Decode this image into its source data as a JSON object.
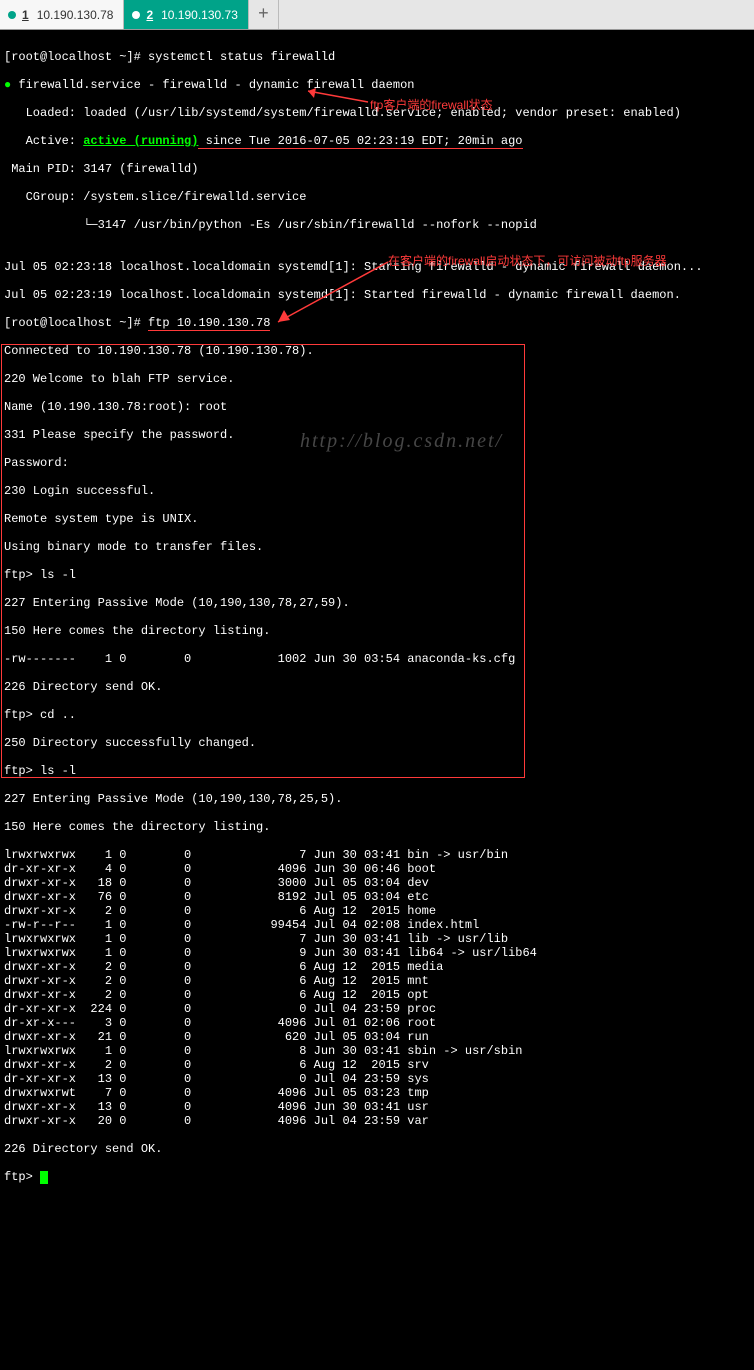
{
  "tabs": {
    "tab1_num": "1",
    "tab1_ip": "10.190.130.78",
    "tab2_num": "2",
    "tab2_ip": "10.190.130.73",
    "newtab": "+"
  },
  "prompt1": "[root@localhost ~]# ",
  "cmd1": "systemctl status firewalld",
  "fw": {
    "l1a": "●",
    "l1b": " firewalld.service - firewalld - dynamic firewall daemon",
    "l2": "   Loaded: loaded (/usr/lib/systemd/system/firewalld.service; enabled; vendor preset: enabled)",
    "l3a": "   Active: ",
    "l3b": "active (running)",
    "l3c": " since Tue 2016-07-05 02:23:19 EDT; 20min ago",
    "l4": " Main PID: 3147 (firewalld)",
    "l5": "   CGroup: /system.slice/firewalld.service",
    "l6": "           └─3147 /usr/bin/python -Es /usr/sbin/firewalld --nofork --nopid",
    "l7": "",
    "l8": "Jul 05 02:23:18 localhost.localdomain systemd[1]: Starting firewalld - dynamic firewall daemon...",
    "l9": "Jul 05 02:23:19 localhost.localdomain systemd[1]: Started firewalld - dynamic firewall daemon."
  },
  "prompt2": "[root@localhost ~]# ",
  "cmd2": "ftp 10.190.130.78",
  "ftp": {
    "l1": "Connected to 10.190.130.78 (10.190.130.78).",
    "l2": "220 Welcome to blah FTP service.",
    "l3": "Name (10.190.130.78:root): root",
    "l4": "331 Please specify the password.",
    "l5": "Password:",
    "l6": "230 Login successful.",
    "l7": "Remote system type is UNIX.",
    "l8": "Using binary mode to transfer files."
  },
  "ls1": {
    "p": "ftp> ls -l",
    "l1": "227 Entering Passive Mode (10,190,130,78,27,59).",
    "l2": "150 Here comes the directory listing.",
    "r1": "-rw-------    1 0        0            1002 Jun 30 03:54 anaconda-ks.cfg",
    "l3": "226 Directory send OK."
  },
  "cd": {
    "p": "ftp> cd ..",
    "l1": "250 Directory successfully changed."
  },
  "ls2": {
    "p": "ftp> ls -l",
    "l1": "227 Entering Passive Mode (10,190,130,78,25,5).",
    "l2": "150 Here comes the directory listing.",
    "rows": [
      "lrwxrwxrwx    1 0        0               7 Jun 30 03:41 bin -> usr/bin",
      "dr-xr-xr-x    4 0        0            4096 Jun 30 06:46 boot",
      "drwxr-xr-x   18 0        0            3000 Jul 05 03:04 dev",
      "drwxr-xr-x   76 0        0            8192 Jul 05 03:04 etc",
      "drwxr-xr-x    2 0        0               6 Aug 12  2015 home",
      "-rw-r--r--    1 0        0           99454 Jul 04 02:08 index.html",
      "lrwxrwxrwx    1 0        0               7 Jun 30 03:41 lib -> usr/lib",
      "lrwxrwxrwx    1 0        0               9 Jun 30 03:41 lib64 -> usr/lib64",
      "drwxr-xr-x    2 0        0               6 Aug 12  2015 media",
      "drwxr-xr-x    2 0        0               6 Aug 12  2015 mnt",
      "drwxr-xr-x    2 0        0               6 Aug 12  2015 opt",
      "dr-xr-xr-x  224 0        0               0 Jul 04 23:59 proc",
      "dr-xr-x---    3 0        0            4096 Jul 01 02:06 root",
      "drwxr-xr-x   21 0        0             620 Jul 05 03:04 run",
      "lrwxrwxrwx    1 0        0               8 Jun 30 03:41 sbin -> usr/sbin",
      "drwxr-xr-x    2 0        0               6 Aug 12  2015 srv",
      "dr-xr-xr-x   13 0        0               0 Jul 04 23:59 sys",
      "drwxrwxrwt    7 0        0            4096 Jul 05 03:23 tmp",
      "drwxr-xr-x   13 0        0            4096 Jun 30 03:41 usr",
      "drwxr-xr-x   20 0        0            4096 Jul 04 23:59 var"
    ],
    "l3": "226 Directory send OK."
  },
  "prompt_end": "ftp> ",
  "ann1": "ftp客户端的firewall状态",
  "ann2": "在客户端的firewall启动状态下，可访问被动ftp服务器",
  "watermark": "http://blog.csdn.net/"
}
